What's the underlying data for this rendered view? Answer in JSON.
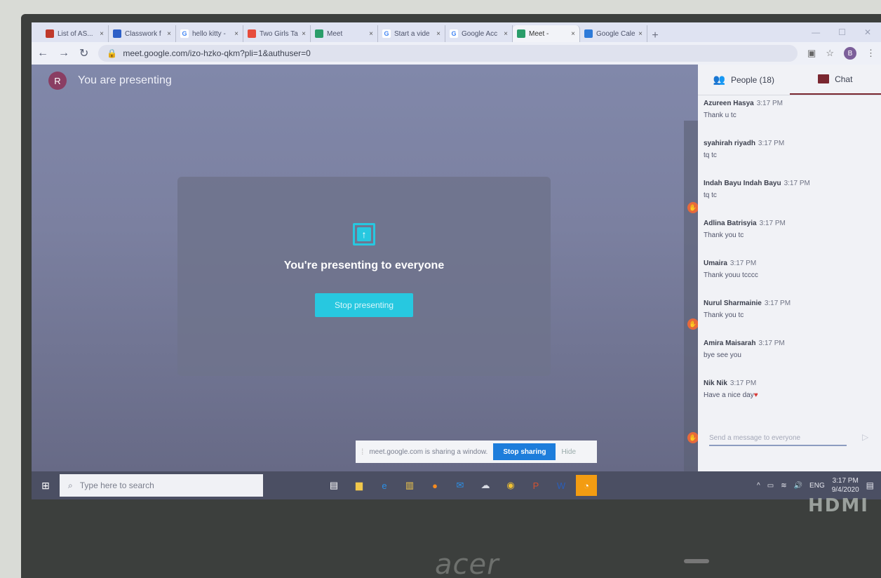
{
  "browser": {
    "tabs": [
      {
        "title": "List of AS...",
        "favicon_color": "#c0392b",
        "favicon_glyph": "",
        "active": false
      },
      {
        "title": "Classwork f",
        "favicon_color": "#2d5fc7",
        "favicon_glyph": "",
        "active": false
      },
      {
        "title": "hello kitty -",
        "favicon_color": "#ffffff",
        "favicon_glyph": "G",
        "active": false
      },
      {
        "title": "Two Girls Ta",
        "favicon_color": "#e74c3c",
        "favicon_glyph": "",
        "active": false
      },
      {
        "title": "Meet",
        "favicon_color": "#2a9d6a",
        "favicon_glyph": "",
        "active": false
      },
      {
        "title": "Start a vide",
        "favicon_color": "#ffffff",
        "favicon_glyph": "G",
        "active": false
      },
      {
        "title": "Google Acc",
        "favicon_color": "#ffffff",
        "favicon_glyph": "G",
        "active": false
      },
      {
        "title": "Meet -",
        "favicon_color": "#2a9d6a",
        "favicon_glyph": "",
        "active": true
      },
      {
        "title": "Google Cale",
        "favicon_color": "#2d7ad9",
        "favicon_glyph": "",
        "active": false
      }
    ],
    "tab_close_glyph": "×",
    "new_tab_glyph": "+",
    "url": "meet.google.com/izo-hzko-qkm?pli=1&authuser=0",
    "profile_initial": "B"
  },
  "meet": {
    "avatar_initial": "R",
    "header_text": "You are presenting",
    "present_message": "You're presenting to everyone",
    "stop_presenting_label": "Stop presenting",
    "share_bar": {
      "text": "meet.google.com is sharing a window.",
      "stop_label": "Stop sharing",
      "hide_label": "Hide"
    }
  },
  "chat_panel": {
    "people_tab": "People (18)",
    "chat_tab": "Chat",
    "accent_color": "#7a2730",
    "messages": [
      {
        "author": "Azureen Hasya",
        "time": "3:17 PM",
        "text": "Thank u tc"
      },
      {
        "author": "syahirah riyadh",
        "time": "3:17 PM",
        "text": "tq tc"
      },
      {
        "author": "Indah Bayu Indah Bayu",
        "time": "3:17 PM",
        "text": "tq tc"
      },
      {
        "author": "Adlina Batrisyia",
        "time": "3:17 PM",
        "text": "Thank you tc"
      },
      {
        "author": "Umaira",
        "time": "3:17 PM",
        "text": "Thank youu tcccc"
      },
      {
        "author": "Nurul Sharmainie",
        "time": "3:17 PM",
        "text": "Thank you tc"
      },
      {
        "author": "Amira Maisarah",
        "time": "3:17 PM",
        "text": "bye see you"
      },
      {
        "author": "Nik Nik",
        "time": "3:17 PM",
        "text": "Have a nice day"
      }
    ],
    "input_placeholder": "Send a message to everyone"
  },
  "taskbar": {
    "search_placeholder": "Type here to search",
    "language": "ENG",
    "time": "3:17 PM",
    "date": "9/4/2020"
  },
  "hardware": {
    "brand": "acer",
    "port_label": "HDMI"
  }
}
